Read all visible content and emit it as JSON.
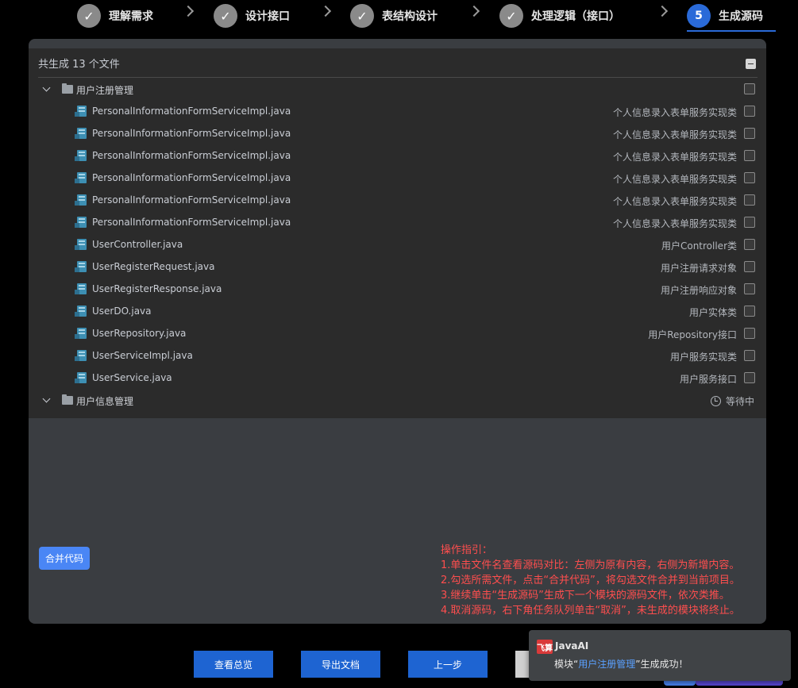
{
  "steps": [
    {
      "label": "理解需求",
      "status": "done",
      "icon": "check-icon",
      "marker": "✓"
    },
    {
      "label": "设计接口",
      "status": "done",
      "icon": "check-icon",
      "marker": "✓"
    },
    {
      "label": "表结构设计",
      "status": "done",
      "icon": "check-icon",
      "marker": "✓"
    },
    {
      "label": "处理逻辑（接口）",
      "status": "done",
      "icon": "check-icon",
      "marker": "✓"
    },
    {
      "label": "生成源码",
      "status": "active",
      "marker": "5"
    }
  ],
  "files_panel": {
    "summary": "共生成 13 个文件",
    "groups": [
      {
        "name": "用户注册管理",
        "expanded": true,
        "files": [
          {
            "name": "PersonalInformationFormServiceImpl.java",
            "desc": "个人信息录入表单服务实现类"
          },
          {
            "name": "PersonalInformationFormServiceImpl.java",
            "desc": "个人信息录入表单服务实现类"
          },
          {
            "name": "PersonalInformationFormServiceImpl.java",
            "desc": "个人信息录入表单服务实现类"
          },
          {
            "name": "PersonalInformationFormServiceImpl.java",
            "desc": "个人信息录入表单服务实现类"
          },
          {
            "name": "PersonalInformationFormServiceImpl.java",
            "desc": "个人信息录入表单服务实现类"
          },
          {
            "name": "PersonalInformationFormServiceImpl.java",
            "desc": "个人信息录入表单服务实现类"
          },
          {
            "name": "UserController.java",
            "desc": "用户Controller类"
          },
          {
            "name": "UserRegisterRequest.java",
            "desc": "用户注册请求对象"
          },
          {
            "name": "UserRegisterResponse.java",
            "desc": "用户注册响应对象"
          },
          {
            "name": "UserDO.java",
            "desc": "用户实体类"
          },
          {
            "name": "UserRepository.java",
            "desc": "用户Repository接口"
          },
          {
            "name": "UserServiceImpl.java",
            "desc": "用户服务实现类"
          },
          {
            "name": "UserService.java",
            "desc": "用户服务接口"
          }
        ]
      },
      {
        "name": "用户信息管理",
        "expanded": false,
        "status": "等待中",
        "status_icon": "history-clock-icon"
      }
    ]
  },
  "merge_button": "合并代码",
  "guide": {
    "title": "操作指引：",
    "lines": [
      "1.单击文件名查看源码对比：左侧为原有内容，右侧为新增内容。",
      "2.勾选所需文件，点击“合并代码”，将勾选文件合并到当前项目。",
      "3.继续单击“生成源码”生成下一个模块的源码文件，依次类推。",
      "4.取消源码，右下角任务队列单击“取消”，未生成的模块将终止。"
    ]
  },
  "bottom_buttons": {
    "overview": "查看总览",
    "export": "导出文档",
    "prev": "上一步"
  },
  "toast": {
    "logo_text": "飞算",
    "title": "JavaAI",
    "message_prefix": "模块“",
    "module": "用户注册管理",
    "message_suffix": "”生成成功！"
  },
  "colors": {
    "accent": "#2a6ad8",
    "button_blue": "#1e64d2",
    "guide_red": "#ff4e4e",
    "file_icon": "#3d8fb3"
  }
}
